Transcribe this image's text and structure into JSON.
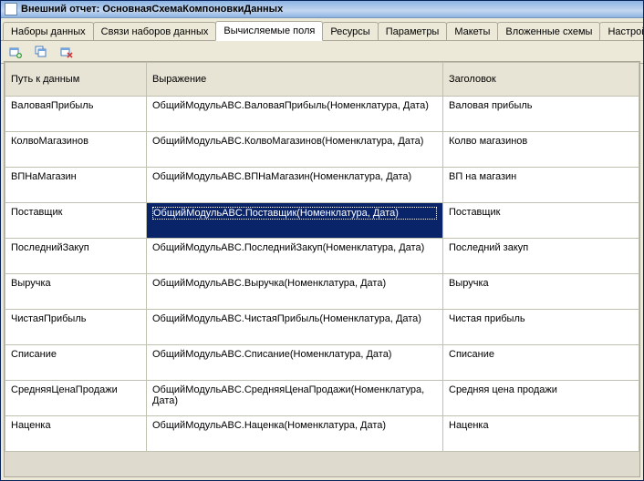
{
  "title": "Внешний отчет: ОсновнаяСхемаКомпоновкиДанных",
  "tabs": {
    "t0": "Наборы данных",
    "t1": "Связи наборов данных",
    "t2": "Вычисляемые поля",
    "t3": "Ресурсы",
    "t4": "Параметры",
    "t5": "Макеты",
    "t6": "Вложенные схемы",
    "t7": "Настройки"
  },
  "columns": {
    "c1": "Путь к данным",
    "c2": "Выражение",
    "c3": "Заголовок"
  },
  "rows": {
    "r0": {
      "p": "ВаловаяПрибыль",
      "e": "ОбщийМодульABC.ВаловаяПрибыль(Номенклатура, Дата)",
      "h": "Валовая прибыль"
    },
    "r1": {
      "p": "КолвоМагазинов",
      "e": "ОбщийМодульABC.КолвоМагазинов(Номенклатура, Дата)",
      "h": "Колво магазинов"
    },
    "r2": {
      "p": "ВПНаМагазин",
      "e": "ОбщийМодульABC.ВПНаМагазин(Номенклатура, Дата)",
      "h": "ВП на магазин"
    },
    "r3": {
      "p": "Поставщик",
      "e": "ОбщийМодульABC.Поставщик(Номенклатура, Дата)",
      "h": "Поставщик"
    },
    "r4": {
      "p": "ПоследнийЗакуп",
      "e": "ОбщийМодульABC.ПоследнийЗакуп(Номенклатура, Дата)",
      "h": "Последний закуп"
    },
    "r5": {
      "p": "Выручка",
      "e": "ОбщийМодульABC.Выручка(Номенклатура, Дата)",
      "h": "Выручка"
    },
    "r6": {
      "p": "ЧистаяПрибыль",
      "e": "ОбщийМодульABC.ЧистаяПрибыль(Номенклатура, Дата)",
      "h": "Чистая прибыль"
    },
    "r7": {
      "p": "Списание",
      "e": "ОбщийМодульABC.Списание(Номенклатура, Дата)",
      "h": "Списание"
    },
    "r8": {
      "p": "СредняяЦенаПродажи",
      "e": "ОбщийМодульABC.СредняяЦенаПродажи(Номенклатура, Дата)",
      "h": "Средняя цена продажи"
    },
    "r9": {
      "p": "Наценка",
      "e": "ОбщийМодульABC.Наценка(Номенклатура, Дата)",
      "h": "Наценка"
    }
  }
}
